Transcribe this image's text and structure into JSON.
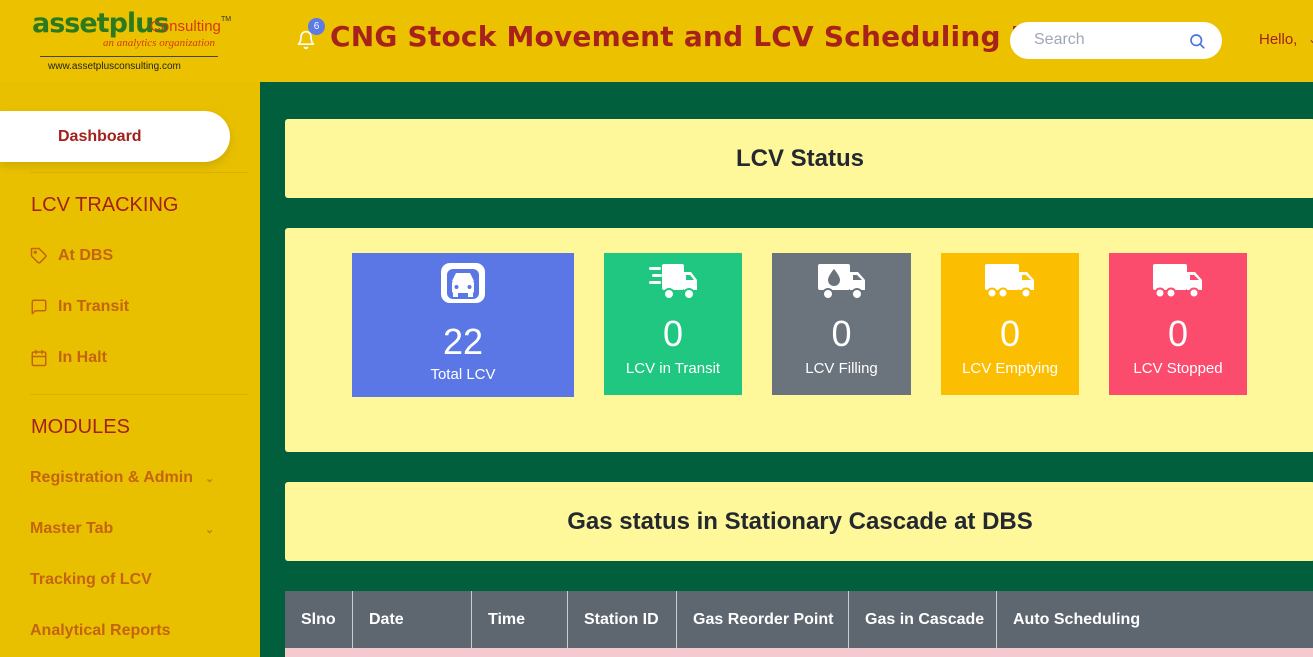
{
  "logo": {
    "brand": "assetplus",
    "consulting": "Consulting",
    "tm": "TM",
    "tagline": "an analytics organization",
    "url": "www.assetplusconsulting.com"
  },
  "header": {
    "title": "CNG Stock Movement and LCV Scheduling D...",
    "notification_count": "6",
    "search_placeholder": "Search",
    "greeting": "Hello,"
  },
  "sidebar": {
    "dashboard": "Dashboard",
    "lcv_tracking_title": "LCV TRACKING",
    "lcv_items": [
      {
        "label": "At DBS",
        "icon": "tag-icon"
      },
      {
        "label": "In Transit",
        "icon": "message-square-icon"
      },
      {
        "label": "In Halt",
        "icon": "calendar-icon"
      }
    ],
    "modules_title": "MODULES",
    "modules": [
      {
        "label": "Registration & Admin",
        "has_dropdown": true
      },
      {
        "label": "Master Tab",
        "has_dropdown": true
      },
      {
        "label": "Tracking of LCV",
        "has_dropdown": false
      },
      {
        "label": "Analytical Reports",
        "has_dropdown": false
      }
    ]
  },
  "lcv_status": {
    "title": "LCV Status",
    "stats": [
      {
        "value": "22",
        "label": "Total LCV",
        "color": "#5b77e6",
        "icon": "bus-icon"
      },
      {
        "value": "0",
        "label": "LCV in Transit",
        "color": "#1fc781",
        "icon": "shipping-fast-icon"
      },
      {
        "value": "0",
        "label": "LCV Filling",
        "color": "#6b737d",
        "icon": "truck-droplet-icon"
      },
      {
        "value": "0",
        "label": "LCV Emptying",
        "color": "#fcbe00",
        "icon": "truck-icon"
      },
      {
        "value": "0",
        "label": "LCV Stopped",
        "color": "#fc4c6e",
        "icon": "truck-icon"
      }
    ]
  },
  "gas_status": {
    "title": "Gas status in Stationary Cascade at DBS",
    "columns": [
      "Slno",
      "Date",
      "Time",
      "Station ID",
      "Gas Reorder Point",
      "Gas in Cascade",
      "Auto Scheduling"
    ]
  },
  "colors": {
    "sidebar_bg": "#e9c000",
    "header_bg": "#ecc200",
    "main_bg": "#025f3d",
    "card_bg": "#fff89a",
    "accent_red": "#a8221c",
    "table_header_bg": "#5e6670"
  }
}
